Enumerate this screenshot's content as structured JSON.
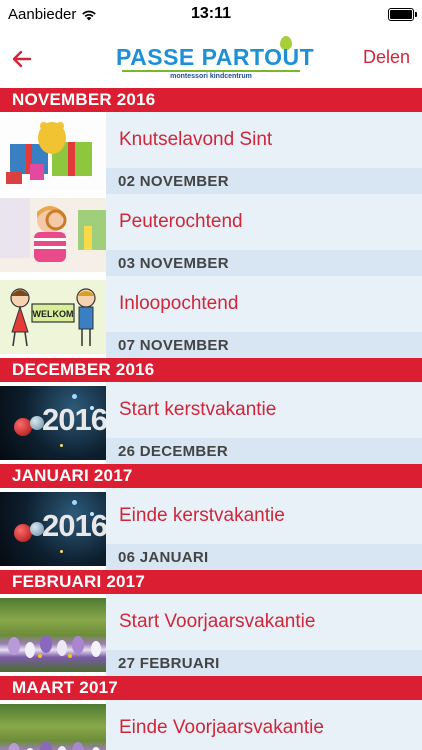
{
  "status": {
    "carrier": "Aanbieder",
    "time": "13:11"
  },
  "nav": {
    "logo_main": "PASSE PARTOUT",
    "logo_sub": "montessori kindcentrum",
    "share_label": "Delen",
    "back_icon": "back-arrow-icon"
  },
  "sections": [
    {
      "header": "NOVEMBER 2016",
      "items": [
        {
          "title": "Knutselavond Sint",
          "date": "02 NOVEMBER",
          "image": "gifts"
        },
        {
          "title": "Peuterochtend",
          "date": "03 NOVEMBER",
          "image": "child"
        },
        {
          "title": "Inloopochtend",
          "date": "07 NOVEMBER",
          "image": "welkom"
        }
      ]
    },
    {
      "header": "DECEMBER 2016",
      "items": [
        {
          "title": "Start kerstvakantie",
          "date": "26 DECEMBER",
          "image": "2016"
        }
      ]
    },
    {
      "header": "JANUARI 2017",
      "items": [
        {
          "title": "Einde kerstvakantie",
          "date": "06 JANUARI",
          "image": "2016"
        }
      ]
    },
    {
      "header": "FEBRUARI 2017",
      "items": [
        {
          "title": "Start Voorjaarsvakantie",
          "date": "27 FEBRUARI",
          "image": "crocus"
        }
      ]
    },
    {
      "header": "MAART 2017",
      "items": [
        {
          "title": "Einde Voorjaarsvakantie",
          "date": "",
          "image": "crocus"
        }
      ]
    }
  ],
  "image_text": {
    "welkom": "WELKOM",
    "year": "2016"
  },
  "colors": {
    "accent": "#dc1e33",
    "title_red": "#d0263a",
    "logo_blue": "#1e90d6",
    "date_band": "#d7e6f2"
  }
}
